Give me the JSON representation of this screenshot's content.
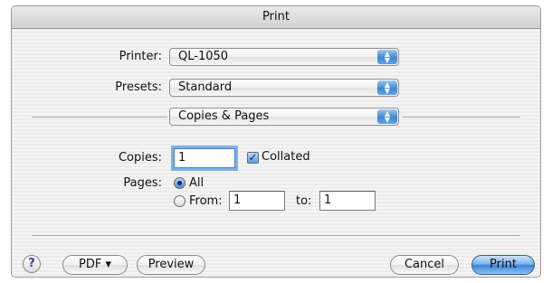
{
  "window": {
    "title": "Print"
  },
  "printer": {
    "label": "Printer:",
    "value": "QL-1050"
  },
  "presets": {
    "label": "Presets:",
    "value": "Standard"
  },
  "section": {
    "value": "Copies & Pages"
  },
  "copies": {
    "label": "Copies:",
    "value": "1",
    "collated_label": "Collated",
    "collated_checked": true
  },
  "pages": {
    "label": "Pages:",
    "all_label": "All",
    "from_label": "From:",
    "from_value": "1",
    "to_label": "to:",
    "to_value": "1",
    "selected": "All"
  },
  "buttons": {
    "help": "?",
    "pdf": "PDF ▾",
    "preview": "Preview",
    "cancel": "Cancel",
    "print": "Print"
  },
  "icons": {
    "popup_arrows": "up-down-arrows-icon",
    "check": "checkmark-icon",
    "help": "question-mark-icon"
  },
  "colors": {
    "accent": "#3d86d8",
    "help_glyph": "#5b2f9c"
  }
}
